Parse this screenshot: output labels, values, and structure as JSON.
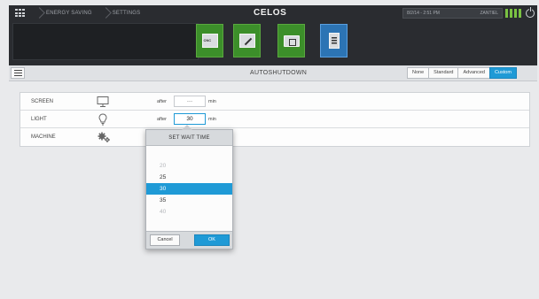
{
  "header": {
    "breadcrumbs": [
      "ENERGY SAVING",
      "SETTINGS"
    ],
    "app_title": "CELOS",
    "datetime": "8/2/14 - 2:51 PM",
    "user": "ZANTIEL",
    "apps": [
      {
        "name": "CNC",
        "icon": "cnc-icon",
        "state": "green"
      },
      {
        "name": "editor",
        "icon": "pencil-icon",
        "state": "green"
      },
      {
        "name": "file-manager",
        "icon": "folder-icon",
        "state": "green"
      },
      {
        "name": "calculator",
        "icon": "calculator-icon",
        "state": "active"
      }
    ]
  },
  "toolbar": {
    "title": "AUTOSHUTDOWN",
    "modes": [
      "None",
      "Standard",
      "Advanced",
      "Custom"
    ],
    "active_mode": "Custom"
  },
  "settings": {
    "rows": [
      {
        "label": "SCREEN",
        "icon": "monitor-icon",
        "after": "after",
        "value": "---",
        "unit": "min"
      },
      {
        "label": "LIGHT",
        "icon": "lightbulb-icon",
        "after": "after",
        "value": "30",
        "unit": "min"
      },
      {
        "label": "MACHINE",
        "icon": "gears-icon"
      }
    ]
  },
  "popover": {
    "title": "SET WAIT TIME",
    "options": [
      "20",
      "25",
      "30",
      "35",
      "40"
    ],
    "selected": "30",
    "cancel_label": "Cancel",
    "ok_label": "OK"
  },
  "colors": {
    "accent": "#1f9ad6",
    "app_green": "#3c8f2a",
    "app_blue": "#2c74b4",
    "topbar": "#2a2c30"
  }
}
